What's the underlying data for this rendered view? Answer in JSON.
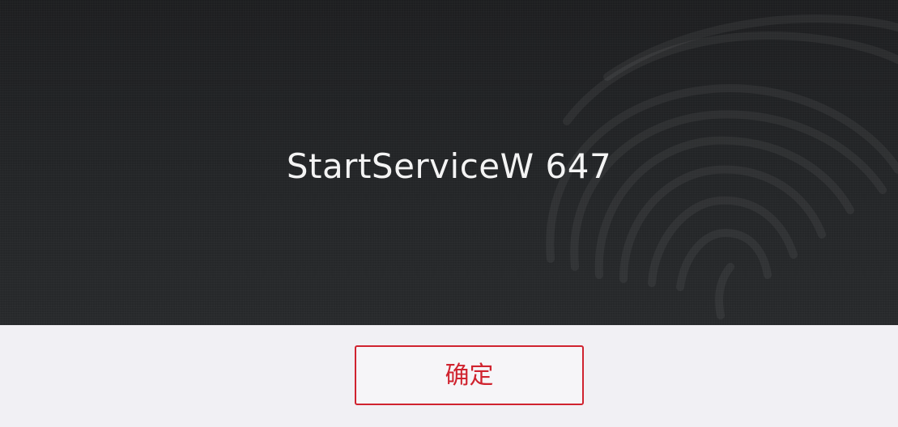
{
  "dialog": {
    "message": "StartServiceW 647",
    "ok_label": "确定",
    "watermark_icon": "fingerprint-icon"
  },
  "colors": {
    "header_background": "#232527",
    "footer_background": "#f1f0f4",
    "accent": "#d0232f",
    "message_text": "#f4f4f4"
  }
}
